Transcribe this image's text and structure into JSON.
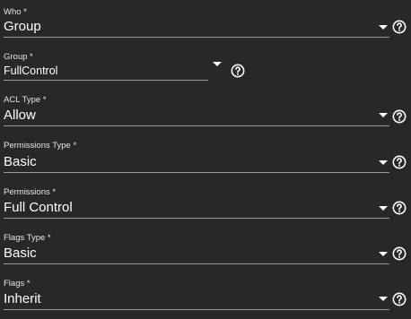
{
  "fields": [
    {
      "label": "Who *",
      "value": "Group",
      "icon": "help-icon"
    },
    {
      "label": "Group *",
      "value": "FullControl",
      "icon": "help-icon"
    },
    {
      "label": "ACL Type *",
      "value": "Allow",
      "icon": "help-icon"
    },
    {
      "label": "Permissions Type *",
      "value": "Basic",
      "icon": "help-icon"
    },
    {
      "label": "Permissions *",
      "value": "Full Control",
      "icon": "help-icon"
    },
    {
      "label": "Flags Type *",
      "value": "Basic",
      "icon": "help-icon"
    },
    {
      "label": "Flags *",
      "value": "Inherit",
      "icon": "help-icon"
    }
  ],
  "colors": {
    "background": "#282828",
    "text": "#ffffff",
    "underline": "#9a9a9a"
  }
}
